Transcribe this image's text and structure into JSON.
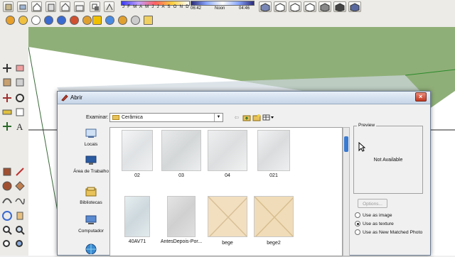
{
  "top_toolbar": {
    "months": "J F M A M J J A S O N D",
    "time_start": "06:42",
    "time_mid": "Noon",
    "time_end": "04:46"
  },
  "dialog": {
    "title": "Abrir",
    "look_in_label": "Examinar:",
    "look_in_value": "Cerâmica",
    "places": [
      {
        "label": "Locais"
      },
      {
        "label": "Área de Trabalho"
      },
      {
        "label": "Bibliotecas"
      },
      {
        "label": "Computador"
      }
    ],
    "files": [
      {
        "name": "02",
        "color": "#e6e8ea"
      },
      {
        "name": "03",
        "color": "#e0e2e3"
      },
      {
        "name": "04",
        "color": "#e4e5e6"
      },
      {
        "name": "021",
        "color": "#e2e4e5"
      },
      {
        "name": "40AV71",
        "color": "#d6e0e4"
      },
      {
        "name": "AntesDepois-Por...",
        "color": "#dcdcdc"
      },
      {
        "name": "bege",
        "color": "#f2dfbf"
      },
      {
        "name": "bege2",
        "color": "#f0dcb8"
      }
    ],
    "preview": {
      "title": "Preview",
      "not_available": "Not Available"
    },
    "options_label": "Options...",
    "radio_options": [
      {
        "label": "Use as image",
        "selected": false
      },
      {
        "label": "Use as texture",
        "selected": true
      },
      {
        "label": "Use as New Matched Photo",
        "selected": false
      }
    ]
  },
  "colors": {
    "viewport_green": "#8faf78",
    "accent_blue": "#3a7ad0"
  }
}
